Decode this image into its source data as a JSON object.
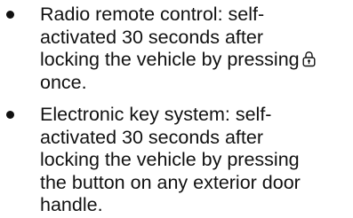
{
  "items": [
    {
      "lines": [
        "Radio remote control: self-",
        "activated 30 seconds after",
        "locking the vehicle by pressing",
        "once."
      ],
      "icon": "lock-button-icon"
    },
    {
      "lines": [
        "Electronic key system: self-",
        "activated 30 seconds after",
        "locking the vehicle by pressing",
        "the button on any exterior door",
        "handle."
      ]
    }
  ]
}
